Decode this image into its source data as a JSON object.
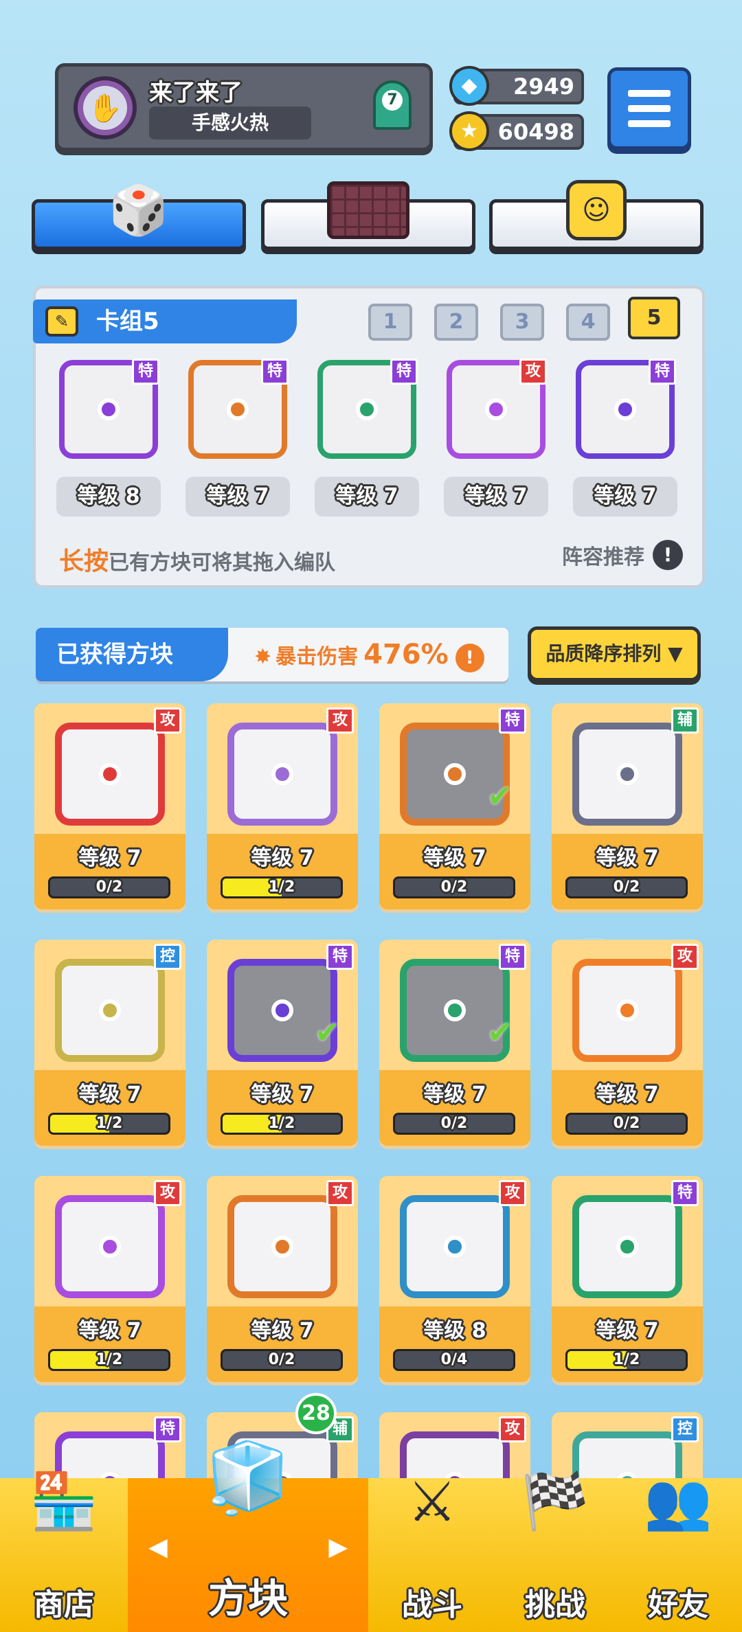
{
  "header": {
    "player_name": "来了来了",
    "player_title": "手感火热",
    "rank_badge": "7",
    "gems": "2949",
    "coins": "60498"
  },
  "icons": {
    "avatar": "handshake-icon",
    "rank": "ribbon-badge-icon",
    "gem": "gem-icon",
    "coin": "coin-icon",
    "menu": "hamburger-menu-icon",
    "tab1": "dice-icon",
    "tab2": "grid-board-icon",
    "tab3": "smile-block-icon",
    "edit": "pencil-icon"
  },
  "deck": {
    "title": "卡组5",
    "numbers": [
      "1",
      "2",
      "3",
      "4",
      "5"
    ],
    "active_number": "5",
    "cards": [
      {
        "tag": "特",
        "level": "等级 8",
        "color": "#8b3fd6"
      },
      {
        "tag": "特",
        "level": "等级 7",
        "color": "#e07a2a"
      },
      {
        "tag": "特",
        "level": "等级 7",
        "color": "#29a36b"
      },
      {
        "tag": "攻",
        "level": "等级 7",
        "color": "#a84de0"
      },
      {
        "tag": "特",
        "level": "等级 7",
        "color": "#6a3fd6"
      }
    ],
    "hint_bold": "长按",
    "hint_rest": "已有方块可将其拖入编队",
    "recommend": "阵容推荐",
    "recommend_icon": "!"
  },
  "owned": {
    "title": "已获得方块",
    "crit_label": "暴击伤害",
    "crit_value": "476%",
    "crit_icon": "!",
    "sort_label": "品质降序排列 ▼",
    "cards": [
      {
        "tag": "攻",
        "level": "等级 7",
        "progress_text": "0/2",
        "progress": 0.0,
        "color": "#e03b3b",
        "checked": false,
        "dim": false
      },
      {
        "tag": "攻",
        "level": "等级 7",
        "progress_text": "1/2",
        "progress": 0.5,
        "color": "#9b6bd6",
        "checked": false,
        "dim": false
      },
      {
        "tag": "特",
        "level": "等级 7",
        "progress_text": "0/2",
        "progress": 0.0,
        "color": "#e07a2a",
        "checked": true,
        "dim": true
      },
      {
        "tag": "辅",
        "level": "等级 7",
        "progress_text": "0/2",
        "progress": 0.0,
        "color": "#6b6f8a",
        "checked": false,
        "dim": false
      },
      {
        "tag": "控",
        "level": "等级 7",
        "progress_text": "1/2",
        "progress": 0.5,
        "color": "#c8b44a",
        "checked": false,
        "dim": false
      },
      {
        "tag": "特",
        "level": "等级 7",
        "progress_text": "1/2",
        "progress": 0.5,
        "color": "#6a3fd6",
        "checked": true,
        "dim": true
      },
      {
        "tag": "特",
        "level": "等级 7",
        "progress_text": "0/2",
        "progress": 0.0,
        "color": "#29a36b",
        "checked": true,
        "dim": true
      },
      {
        "tag": "攻",
        "level": "等级 7",
        "progress_text": "0/2",
        "progress": 0.0,
        "color": "#f07d28",
        "checked": false,
        "dim": false
      },
      {
        "tag": "攻",
        "level": "等级 7",
        "progress_text": "1/2",
        "progress": 0.5,
        "color": "#a84de0",
        "checked": false,
        "dim": false
      },
      {
        "tag": "攻",
        "level": "等级 7",
        "progress_text": "0/2",
        "progress": 0.0,
        "color": "#e07a2a",
        "checked": false,
        "dim": false
      },
      {
        "tag": "攻",
        "level": "等级 8",
        "progress_text": "0/4",
        "progress": 0.0,
        "color": "#2f8fc8",
        "checked": false,
        "dim": false
      },
      {
        "tag": "特",
        "level": "等级 7",
        "progress_text": "1/2",
        "progress": 0.5,
        "color": "#29a36b",
        "checked": false,
        "dim": false
      },
      {
        "tag": "特",
        "level": "",
        "progress_text": "",
        "progress": 0.0,
        "color": "#8b3fd6",
        "checked": false,
        "dim": false
      },
      {
        "tag": "辅",
        "level": "",
        "progress_text": "",
        "progress": 0.0,
        "color": "#6b6f8a",
        "checked": false,
        "dim": false
      },
      {
        "tag": "攻",
        "level": "",
        "progress_text": "",
        "progress": 0.0,
        "color": "#7a3fa0",
        "checked": false,
        "dim": false
      },
      {
        "tag": "控",
        "level": "",
        "progress_text": "",
        "progress": 0.0,
        "color": "#3fa89a",
        "checked": false,
        "dim": false
      }
    ],
    "new_count": "28"
  },
  "nav": {
    "items": [
      {
        "label": "商店",
        "icon": "shop-icon"
      },
      {
        "label": "方块",
        "icon": "block-icon"
      },
      {
        "label": "战斗",
        "icon": "battle-icon"
      },
      {
        "label": "挑战",
        "icon": "challenge-icon"
      },
      {
        "label": "好友",
        "icon": "friends-icon"
      }
    ],
    "arrow_left": "◀",
    "arrow_right": "▶"
  }
}
